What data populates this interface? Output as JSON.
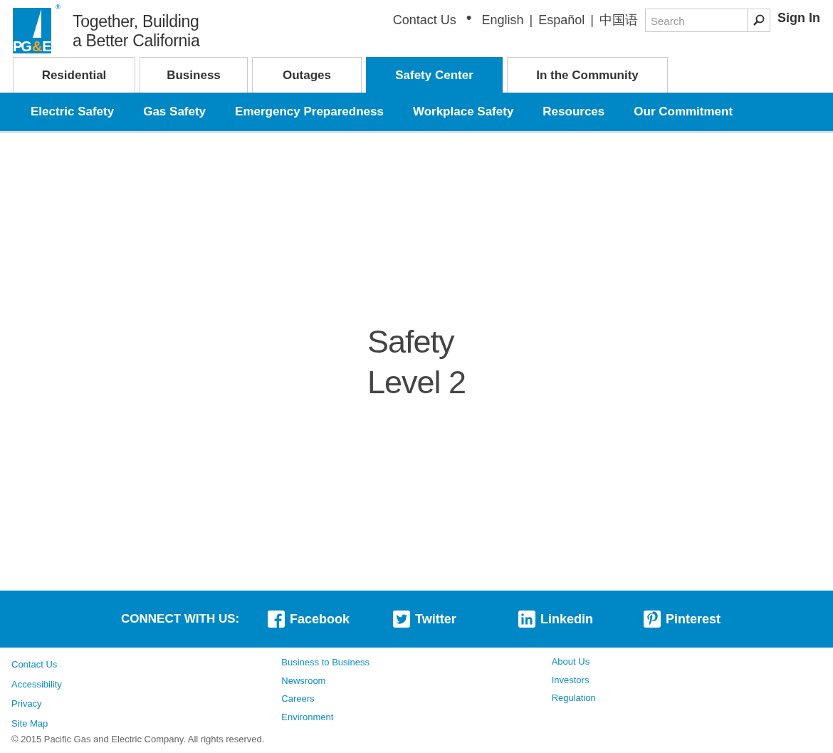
{
  "header": {
    "logo": {
      "parts": [
        {
          "text": "PG",
          "accent": false
        },
        {
          "text": "&",
          "accent": true
        },
        {
          "text": "E",
          "accent": false
        }
      ],
      "mark": "®"
    },
    "tagline": [
      "Together, Building",
      "a Better California"
    ],
    "utility_links": [
      {
        "label": "Contact Us",
        "separator": "•"
      },
      {
        "label": "English",
        "separator": "|"
      },
      {
        "label": "Español",
        "separator": "|"
      },
      {
        "label": "中国语"
      }
    ],
    "search": {
      "placeholder": "Search"
    },
    "sign_in": "Sign In"
  },
  "tabs": [
    {
      "label": "Residential",
      "selected": false
    },
    {
      "label": "Business",
      "selected": false
    },
    {
      "label": "Outages",
      "selected": false
    },
    {
      "label": "Safety Center",
      "selected": true
    },
    {
      "label": "In the Community",
      "selected": false
    }
  ],
  "subnav": [
    "Electric Safety",
    "Gas Safety",
    "Emergency Preparedness",
    "Workplace Safety",
    "Resources",
    "Our Commitment"
  ],
  "content": {
    "heading": [
      "Safety",
      "Level 2"
    ]
  },
  "social": {
    "label": "CONNECT WITH US:",
    "links": [
      {
        "kind": "facebook",
        "label": "Facebook"
      },
      {
        "kind": "twitter",
        "label": "Twitter"
      },
      {
        "kind": "linkedin",
        "label": "Linkedin"
      },
      {
        "kind": "pinterest",
        "label": "Pinterest"
      }
    ]
  },
  "footer": {
    "columns": [
      [
        "Contact Us",
        "Accessibility",
        "Privacy",
        "Site Map"
      ],
      [
        "Business to Business",
        "Newsroom",
        "Careers",
        "Environment"
      ],
      [
        "About Us",
        "Investors",
        "Regulation"
      ]
    ],
    "copyright": "© 2015  Pacific Gas and Electric Company. All rights reserved."
  }
}
